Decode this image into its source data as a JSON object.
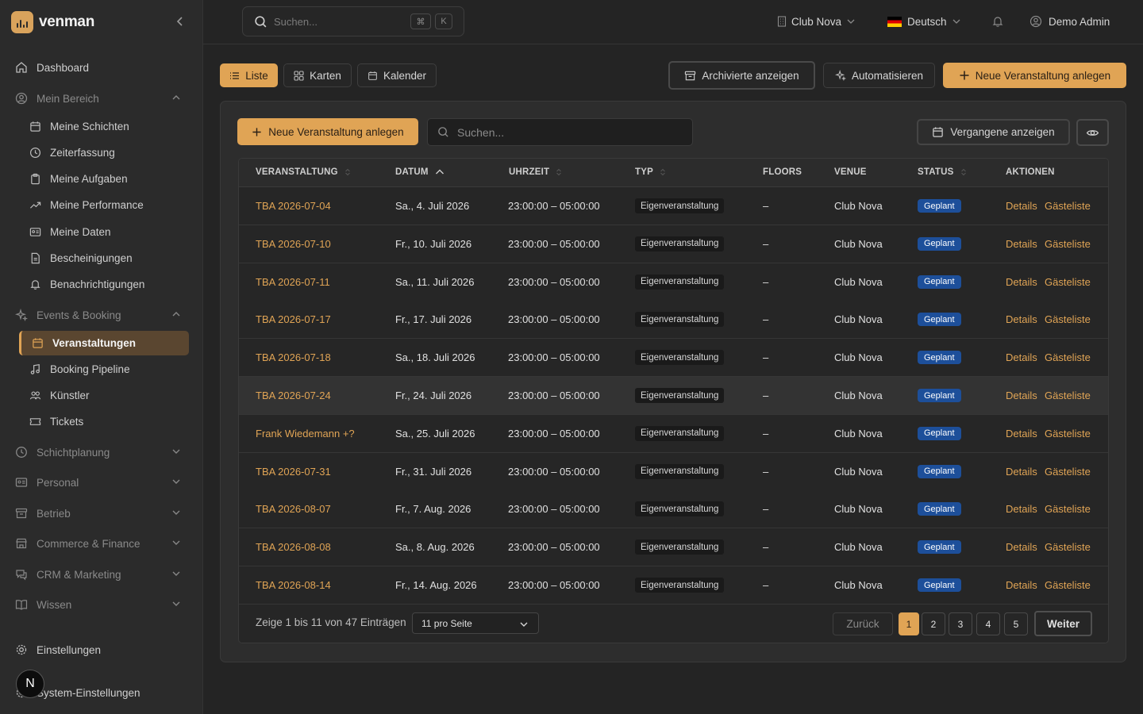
{
  "brand": {
    "name": "venman"
  },
  "sidebar": {
    "items": [
      {
        "label": "Dashboard"
      },
      {
        "label": "Mein Bereich"
      },
      {
        "label": "Meine Schichten"
      },
      {
        "label": "Zeiterfassung"
      },
      {
        "label": "Meine Aufgaben"
      },
      {
        "label": "Meine Performance"
      },
      {
        "label": "Meine Daten"
      },
      {
        "label": "Bescheinigungen"
      },
      {
        "label": "Benachrichtigungen"
      },
      {
        "label": "Events & Booking"
      },
      {
        "label": "Veranstaltungen"
      },
      {
        "label": "Booking Pipeline"
      },
      {
        "label": "Künstler"
      },
      {
        "label": "Tickets"
      },
      {
        "label": "Schichtplanung"
      },
      {
        "label": "Personal"
      },
      {
        "label": "Betrieb"
      },
      {
        "label": "Commerce & Finance"
      },
      {
        "label": "CRM & Marketing"
      },
      {
        "label": "Wissen"
      },
      {
        "label": "Einstellungen"
      },
      {
        "label": "System-Einstellungen"
      }
    ],
    "avatar_letter": "N"
  },
  "topbar": {
    "search_placeholder": "Suchen...",
    "kbd1": "⌘",
    "kbd2": "K",
    "venue": "Club Nova",
    "language": "Deutsch",
    "user": "Demo Admin"
  },
  "toolbar": {
    "view_list": "Liste",
    "view_cards": "Karten",
    "view_calendar": "Kalender",
    "archived": "Archivierte anzeigen",
    "automate": "Automatisieren",
    "new_event": "Neue Veranstaltung anlegen"
  },
  "card": {
    "new_event": "Neue Veranstaltung anlegen",
    "search_placeholder": "Suchen...",
    "past": "Vergangene anzeigen"
  },
  "table": {
    "headers": [
      "VERANSTALTUNG",
      "DATUM",
      "UHRZEIT",
      "TYP",
      "FLOORS",
      "VENUE",
      "STATUS",
      "AKTIONEN"
    ],
    "action_details": "Details",
    "action_guestlist": "Gästeliste",
    "rows": [
      {
        "name": "TBA 2026-07-04",
        "date": "Sa., 4. Juli 2026",
        "time": "23:00:00 – 05:00:00",
        "type": "Eigenveranstaltung",
        "floors": "–",
        "venue": "Club Nova",
        "status": "Geplant"
      },
      {
        "name": "TBA 2026-07-10",
        "date": "Fr., 10. Juli 2026",
        "time": "23:00:00 – 05:00:00",
        "type": "Eigenveranstaltung",
        "floors": "–",
        "venue": "Club Nova",
        "status": "Geplant"
      },
      {
        "name": "TBA 2026-07-11",
        "date": "Sa., 11. Juli 2026",
        "time": "23:00:00 – 05:00:00",
        "type": "Eigenveranstaltung",
        "floors": "–",
        "venue": "Club Nova",
        "status": "Geplant"
      },
      {
        "name": "TBA 2026-07-17",
        "date": "Fr., 17. Juli 2026",
        "time": "23:00:00 – 05:00:00",
        "type": "Eigenveranstaltung",
        "floors": "–",
        "venue": "Club Nova",
        "status": "Geplant"
      },
      {
        "name": "TBA 2026-07-18",
        "date": "Sa., 18. Juli 2026",
        "time": "23:00:00 – 05:00:00",
        "type": "Eigenveranstaltung",
        "floors": "–",
        "venue": "Club Nova",
        "status": "Geplant"
      },
      {
        "name": "TBA 2026-07-24",
        "date": "Fr., 24. Juli 2026",
        "time": "23:00:00 – 05:00:00",
        "type": "Eigenveranstaltung",
        "floors": "–",
        "venue": "Club Nova",
        "status": "Geplant"
      },
      {
        "name": "Frank Wiedemann +?",
        "date": "Sa., 25. Juli 2026",
        "time": "23:00:00 – 05:00:00",
        "type": "Eigenveranstaltung",
        "floors": "–",
        "venue": "Club Nova",
        "status": "Geplant"
      },
      {
        "name": "TBA 2026-07-31",
        "date": "Fr., 31. Juli 2026",
        "time": "23:00:00 – 05:00:00",
        "type": "Eigenveranstaltung",
        "floors": "–",
        "venue": "Club Nova",
        "status": "Geplant"
      },
      {
        "name": "TBA 2026-08-07",
        "date": "Fr., 7. Aug. 2026",
        "time": "23:00:00 – 05:00:00",
        "type": "Eigenveranstaltung",
        "floors": "–",
        "venue": "Club Nova",
        "status": "Geplant"
      },
      {
        "name": "TBA 2026-08-08",
        "date": "Sa., 8. Aug. 2026",
        "time": "23:00:00 – 05:00:00",
        "type": "Eigenveranstaltung",
        "floors": "–",
        "venue": "Club Nova",
        "status": "Geplant"
      },
      {
        "name": "TBA 2026-08-14",
        "date": "Fr., 14. Aug. 2026",
        "time": "23:00:00 – 05:00:00",
        "type": "Eigenveranstaltung",
        "floors": "–",
        "venue": "Club Nova",
        "status": "Geplant"
      }
    ]
  },
  "pagination": {
    "info": "Zeige 1 bis 11 von 47 Einträgen",
    "per_page": "11 pro Seite",
    "prev": "Zurück",
    "pages": [
      "1",
      "2",
      "3",
      "4",
      "5"
    ],
    "next": "Weiter"
  },
  "colors": {
    "accent": "#e0a455",
    "status_blue": "#1d4f9a",
    "background": "#242424"
  }
}
